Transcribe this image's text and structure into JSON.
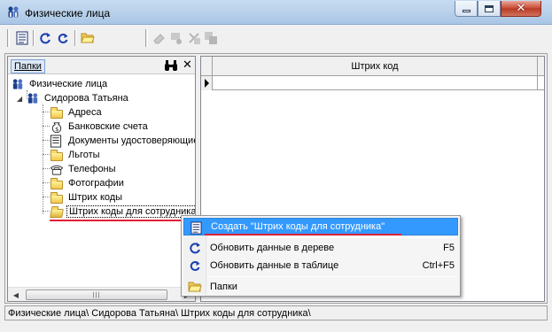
{
  "window": {
    "title": "Физические лица",
    "icon": "people-icon",
    "controls": [
      "minimize",
      "maximize",
      "close"
    ]
  },
  "toolbar": {
    "buttons": [
      {
        "icon": "document-icon",
        "enabled": true
      },
      {
        "icon": "refresh-tree-icon",
        "enabled": true
      },
      {
        "icon": "refresh-icon",
        "enabled": true
      },
      {
        "icon": "folder-open-icon",
        "enabled": true
      },
      {
        "icon": "eraser-icon",
        "enabled": false
      },
      {
        "icon": "move-icon",
        "enabled": false
      },
      {
        "icon": "delete-icon",
        "enabled": false
      },
      {
        "icon": "copy-icon",
        "enabled": false
      }
    ]
  },
  "left_pane": {
    "tab_label": "Папки",
    "find_icon": "binoculars-icon",
    "close_icon": "close-icon",
    "tree": {
      "root": "Физические лица",
      "person": "Сидорова Татьяна",
      "children": [
        {
          "label": "Адреса",
          "icon": "folder-icon"
        },
        {
          "label": "Банковские счета",
          "icon": "money-bag-icon"
        },
        {
          "label": "Документы удостоверяющие",
          "icon": "document-icon"
        },
        {
          "label": "Льготы",
          "icon": "folder-icon"
        },
        {
          "label": "Телефоны",
          "icon": "phone-icon"
        },
        {
          "label": "Фотографии",
          "icon": "folder-icon"
        },
        {
          "label": "Штрих коды",
          "icon": "folder-icon"
        },
        {
          "label": "Штрих коды для сотрудника",
          "icon": "folder-open-icon",
          "selected": true
        }
      ]
    }
  },
  "grid": {
    "columns": [
      "Штрих код"
    ],
    "rows": []
  },
  "context_menu": {
    "items": [
      {
        "label": "Создать \"Штрих коды для сотрудника\"",
        "shortcut": "",
        "icon": "document-icon",
        "highlighted": true
      },
      {
        "label": "Обновить данные в дереве",
        "shortcut": "F5",
        "icon": "refresh-tree-icon"
      },
      {
        "label": "Обновить данные в таблице",
        "shortcut": "Ctrl+F5",
        "icon": "refresh-icon"
      },
      {
        "label": "Папки",
        "shortcut": "",
        "icon": "folder-open-icon"
      }
    ]
  },
  "statusbar": {
    "path": "Физические лица\\ Сидорова Татьяна\\ Штрих коды для сотрудника\\"
  },
  "colors": {
    "menu_highlight": "#3399ff",
    "annotation_red": "#e0203a",
    "titlebar": "#b9d1ea"
  }
}
